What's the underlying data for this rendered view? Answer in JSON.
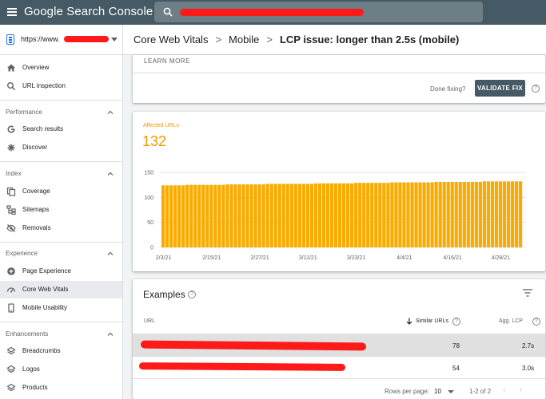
{
  "app": {
    "title": "Google Search Console",
    "search_value": "",
    "property_url": "https://www."
  },
  "breadcrumb": [
    "Core Web Vitals",
    "Mobile",
    "LCP issue: longer than 2.5s (mobile)"
  ],
  "sidebar": {
    "top_items": [
      {
        "label": "Overview",
        "icon": "home-icon"
      },
      {
        "label": "URL inspection",
        "icon": "search-icon"
      }
    ],
    "sections": [
      {
        "title": "Performance",
        "items": [
          {
            "label": "Search results",
            "icon": "google-g-icon"
          },
          {
            "label": "Discover",
            "icon": "asterisk-icon"
          }
        ]
      },
      {
        "title": "Index",
        "items": [
          {
            "label": "Coverage",
            "icon": "copy-icon"
          },
          {
            "label": "Sitemaps",
            "icon": "sitemap-icon"
          },
          {
            "label": "Removals",
            "icon": "eye-off-icon"
          }
        ]
      },
      {
        "title": "Experience",
        "items": [
          {
            "label": "Page Experience",
            "icon": "plus-circle-icon"
          },
          {
            "label": "Core Web Vitals",
            "icon": "speedometer-icon",
            "active": true
          },
          {
            "label": "Mobile Usability",
            "icon": "phone-icon"
          }
        ]
      },
      {
        "title": "Enhancements",
        "items": [
          {
            "label": "Breadcrumbs",
            "icon": "layers-icon"
          },
          {
            "label": "Logos",
            "icon": "layers-icon"
          },
          {
            "label": "Products",
            "icon": "layers-icon"
          }
        ]
      }
    ]
  },
  "issue_card": {
    "learn_more": "LEARN MORE",
    "done_fixing": "Done fixing?",
    "validate_label": "VALIDATE FIX"
  },
  "affected": {
    "label": "Affected URLs",
    "count": "132"
  },
  "chart_data": {
    "type": "bar",
    "color": "#f9ab00",
    "ylim": [
      0,
      150
    ],
    "yticks": [
      0,
      50,
      100,
      150
    ],
    "xtick_labels": [
      "2/3/21",
      "2/15/21",
      "2/27/21",
      "3/11/21",
      "3/23/21",
      "4/4/21",
      "4/16/21",
      "4/28/21"
    ],
    "start_label": "2/3/21",
    "num_days": 90,
    "values": [
      124,
      124,
      124,
      124,
      124,
      124,
      125,
      125,
      125,
      125,
      125,
      125,
      125,
      125,
      125,
      125,
      126,
      126,
      126,
      126,
      126,
      126,
      126,
      126,
      126,
      126,
      127,
      127,
      127,
      127,
      127,
      127,
      127,
      127,
      127,
      127,
      127,
      127,
      128,
      128,
      128,
      128,
      128,
      128,
      128,
      128,
      128,
      128,
      129,
      129,
      129,
      129,
      129,
      129,
      129,
      129,
      129,
      130,
      130,
      130,
      130,
      130,
      130,
      130,
      130,
      130,
      130,
      130,
      131,
      131,
      131,
      131,
      131,
      131,
      131,
      131,
      131,
      131,
      131,
      131,
      132,
      132,
      132,
      132,
      132,
      132,
      132,
      132,
      132,
      132
    ]
  },
  "examples": {
    "title": "Examples",
    "columns": {
      "url": "URL",
      "similar": "Similar URLs",
      "lcp": "Agg. LCP"
    },
    "rows": [
      {
        "similar": "78",
        "lcp": "2.7s"
      },
      {
        "similar": "54",
        "lcp": "3.0s"
      }
    ],
    "footer": {
      "rows_per_page_label": "Rows per page:",
      "rows_per_page": "10",
      "range": "1-2 of 2"
    }
  },
  "colors": {
    "topbar": "#455a64",
    "accent_orange": "#f29900",
    "bar": "#f9ab00",
    "redaction": "#ff1a1a"
  }
}
